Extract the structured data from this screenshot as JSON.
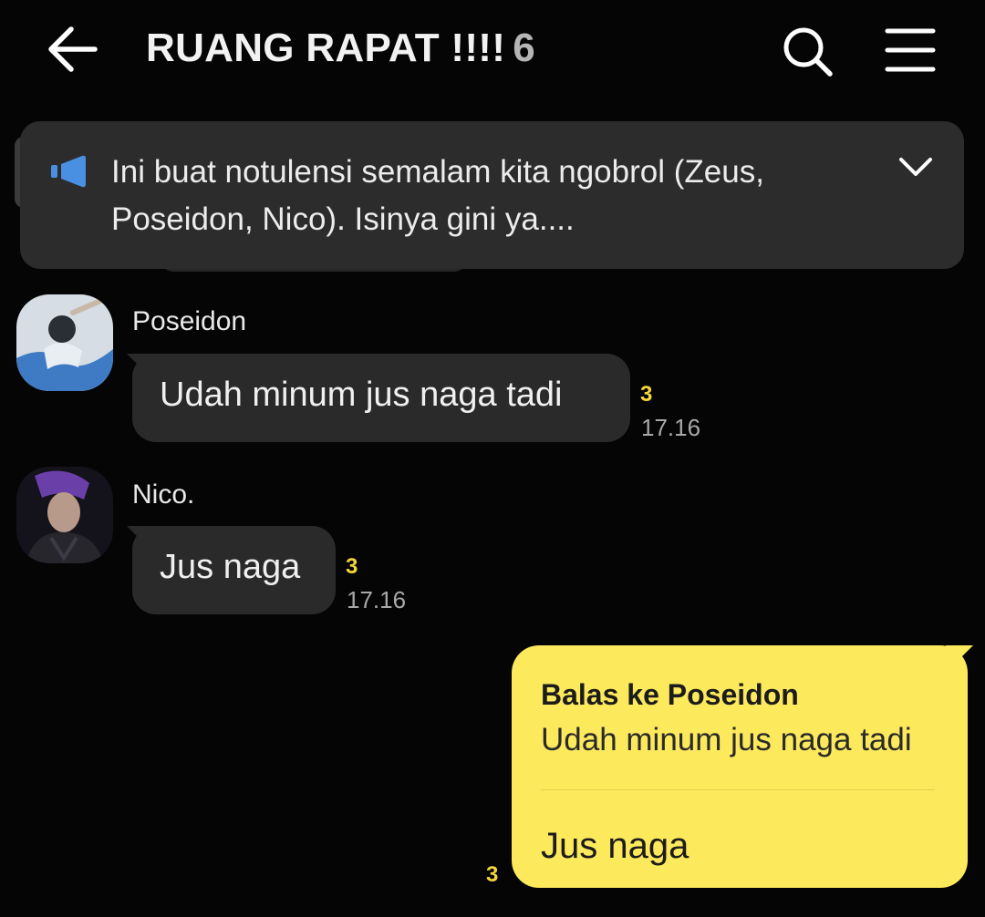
{
  "header": {
    "title": "RUANG RAPAT !!!!",
    "member_count": "6",
    "back_icon": "arrow-left-icon",
    "search_icon": "search-icon",
    "menu_icon": "hamburger-menu-icon"
  },
  "notice": {
    "icon": "megaphone-icon",
    "text": "Ini buat notulensi semalam kita ngobrol (Zeus, Poseidon, Nico). Isinya gini ya....",
    "expand_icon": "chevron-down-icon"
  },
  "messages": [
    {
      "sender": "Poseidon",
      "text": "Udah minum jus naga tadi",
      "unread": "3",
      "time": "17.16"
    },
    {
      "sender": "Nico.",
      "text": "Jus naga",
      "unread": "3",
      "time": "17.16"
    }
  ],
  "outgoing": {
    "reply_label": "Balas ke Poseidon",
    "reply_quote": "Udah minum jus naga tadi",
    "text": "Jus naga",
    "unread": "3"
  },
  "colors": {
    "background": "#050505",
    "incoming_bubble": "#2a2a2a",
    "outgoing_bubble": "#fde95c",
    "unread_count": "#f5d63a",
    "notice_icon": "#4a90e2"
  }
}
